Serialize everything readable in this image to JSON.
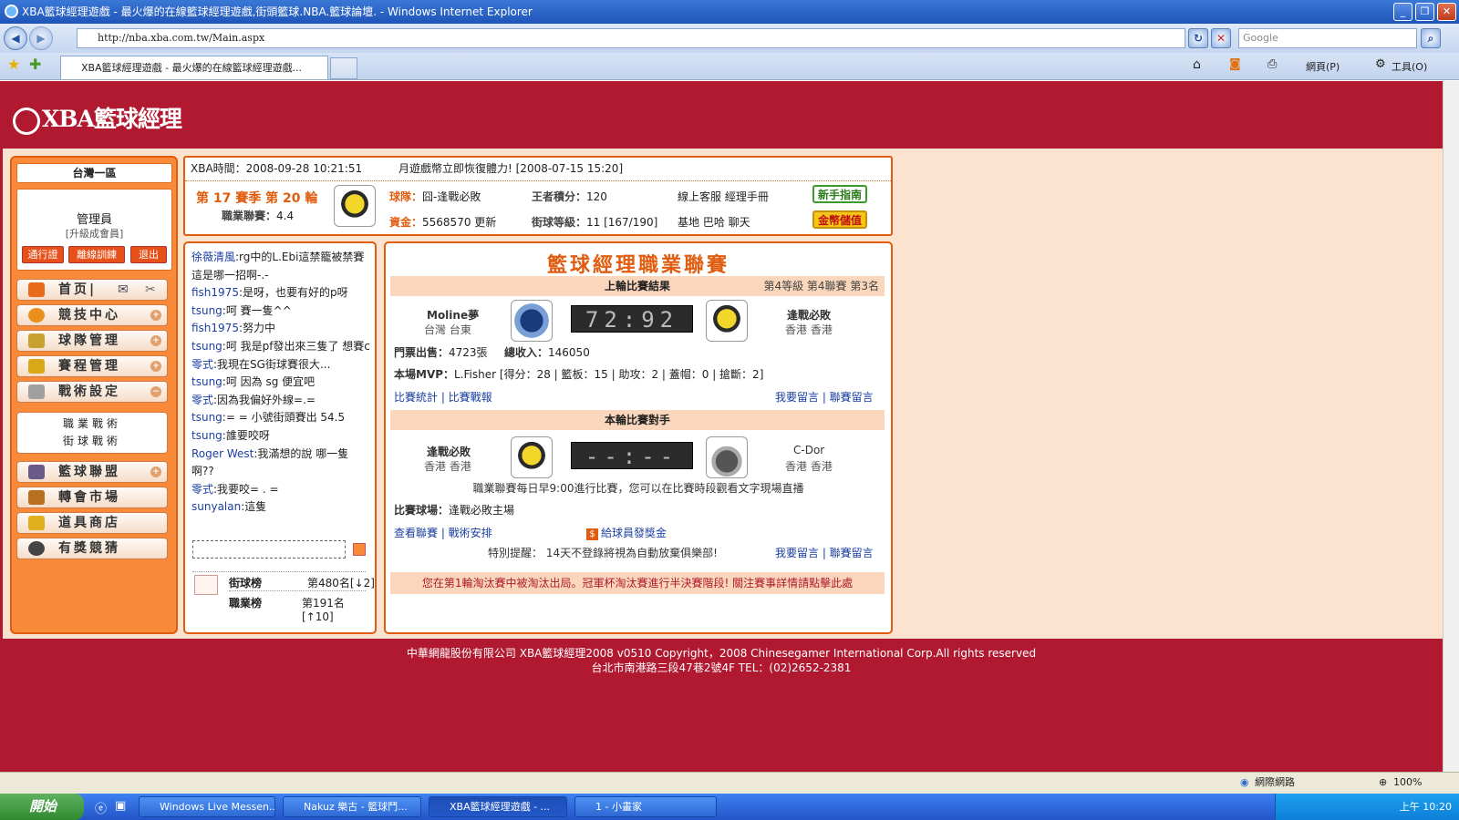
{
  "window": {
    "title": "XBA籃球經理遊戲 - 最火爆的在線籃球經理遊戲,街頭籃球.NBA.籃球論壇. - Windows Internet Explorer",
    "url": "http://nba.xba.com.tw/Main.aspx",
    "search_placeholder": "Google",
    "tab_title": "XBA籃球經理遊戲 - 最火爆的在線籃球經理遊戲...",
    "toolbar_page": "網頁(P)",
    "toolbar_tools": "工具(O)"
  },
  "site": {
    "logo": "XBA籃球經理"
  },
  "sidebar": {
    "region": "台灣一區",
    "username": "管理員",
    "user_level": "[升級成會員]",
    "buttons": [
      "通行證",
      "離線訓練",
      "退出"
    ],
    "menu": [
      {
        "label": "首页|",
        "icon": "home-icon"
      },
      {
        "label": "競技中心",
        "icon": "basketball-icon"
      },
      {
        "label": "球隊管理",
        "icon": "team-icon"
      },
      {
        "label": "賽程管理",
        "icon": "trophy-icon"
      },
      {
        "label": "戰術設定",
        "icon": "tactics-icon"
      },
      {
        "label": "籃球聯盟",
        "icon": "league-icon"
      },
      {
        "label": "轉會市場",
        "icon": "hammer-icon"
      },
      {
        "label": "道具商店",
        "icon": "shop-icon"
      },
      {
        "label": "有獎競猜",
        "icon": "guess-icon"
      }
    ],
    "submenu": [
      "職業戰術",
      "街球戰術"
    ]
  },
  "info": {
    "time_label": "XBA時間：",
    "time": "2008-09-28 10:21:51",
    "news": "月遊戲幣立即恢復體力! [2008-07-15 15:20]",
    "season": "第 17 賽季 第 20 輪",
    "pro_points_label": "職業聯賽：",
    "pro_points": "4.4",
    "team_label": "球隊：",
    "team": "囧-逢戰必敗",
    "king_label": "王者積分：",
    "king": "120",
    "links1": "線上客服  經理手冊",
    "funds_label": "資金：",
    "funds": "5568570",
    "update": "更新",
    "street_label": "街球等級：",
    "street": "11 [167/190]",
    "links2": "基地  巴哈  聊天",
    "btn_newbie": "新手指南",
    "btn_gold": "金幣儲值"
  },
  "chat": {
    "lines": [
      {
        "user": "徐薇清風",
        "text": ":rg中的L.Ebi這禁籠被禁賽 這是哪一招啊-.-"
      },
      {
        "user": "fish1975",
        "text": ":是呀，也要有好的p呀"
      },
      {
        "user": "tsung",
        "text": ":呵  賽一隻^^"
      },
      {
        "user": "fish1975",
        "text": ":努力中"
      },
      {
        "user": "tsung",
        "text": ":呵  我是pf發出來三隻了  想賽c"
      },
      {
        "user": "零式",
        "text": ":我現在SG街球賽很大..."
      },
      {
        "user": "tsung",
        "text": ":呵  因為  sg 便宜吧"
      },
      {
        "user": "零式",
        "text": ":因為我偏好外線=.="
      },
      {
        "user": "tsung",
        "text": ":= = 小號街頭賽出  54.5"
      },
      {
        "user": "tsung",
        "text": ":誰要咬呀"
      },
      {
        "user": "Roger West",
        "text": ":我滿想的說  哪一隻啊??"
      },
      {
        "user": "零式",
        "text": ":我要咬= . ="
      },
      {
        "user": "sunyalan",
        "text": ":這隻"
      }
    ],
    "rank1_label": "街球榜",
    "rank1_value": "第480名[↓2]",
    "rank2_label": "職業榜",
    "rank2_value": "第191名[↑10]"
  },
  "match": {
    "title": "籃球經理職業聯賽",
    "last_header": "上輪比賽結果",
    "last_meta": "第4等級  第4聯賽  第3名",
    "last_home": "Moline夢",
    "last_home_loc": "台灣  台東",
    "last_score": "72:92",
    "last_away": "逢戰必敗",
    "last_away_loc": "香港  香港",
    "tickets_label": "門票出售：",
    "tickets": "4723張",
    "income_label": "總收入：",
    "income": "146050",
    "mvp_label": "本場MVP：",
    "mvp": "L.Fisher [得分：28 | 籃板：15 | 助攻：2 | 蓋帽：0 | 搶斷：2]",
    "links_left": "比賽統計 | 比賽戰報",
    "links_right": "我要留言 | 聯賽留言",
    "next_header": "本輪比賽對手",
    "next_home": "逢戰必敗",
    "next_home_loc": "香港  香港",
    "next_score": "--:--",
    "next_away": "C-Dor",
    "next_away_loc": "香港  香港",
    "schedule_note": "職業聯賽每日早9:00進行比賽，您可以在比賽時段觀看文字現場直播",
    "arena_label": "比賽球場：",
    "arena": "逢戰必敗主場",
    "links_left2": "查看聯賽 | 戰術安排",
    "bonus": "給球員發獎金",
    "warning": "特別提醒：  14天不登錄將視為自動放棄俱樂部!",
    "links_right2": "我要留言 | 聯賽留言",
    "notice": "您在第1輪淘汰賽中被淘汰出局。冠軍杯淘汰賽進行半決賽階段! 關注賽事詳情請點擊此處"
  },
  "footer": {
    "line1": "中華網龍股份有限公司  XBA籃球經理2008 v0510     Copyright，2008 Chinesegamer International Corp.All rights reserved",
    "line2": "台北市南港路三段47巷2號4F TEL：(02)2652-2381"
  },
  "statusbar": {
    "zone": "網際網路",
    "zoom": "100%"
  },
  "taskbar": {
    "start": "開始",
    "tasks": [
      "Windows Live Messen...",
      "Nakuz 樂古 - 籃球鬥...",
      "XBA籃球經理遊戲 - ...",
      "1 - 小畫家"
    ],
    "clock": "上午 10:20"
  },
  "colors": {
    "brand_red": "#b0192f",
    "accent_orange": "#e05d10",
    "panel_bg": "#fbe3cf"
  }
}
